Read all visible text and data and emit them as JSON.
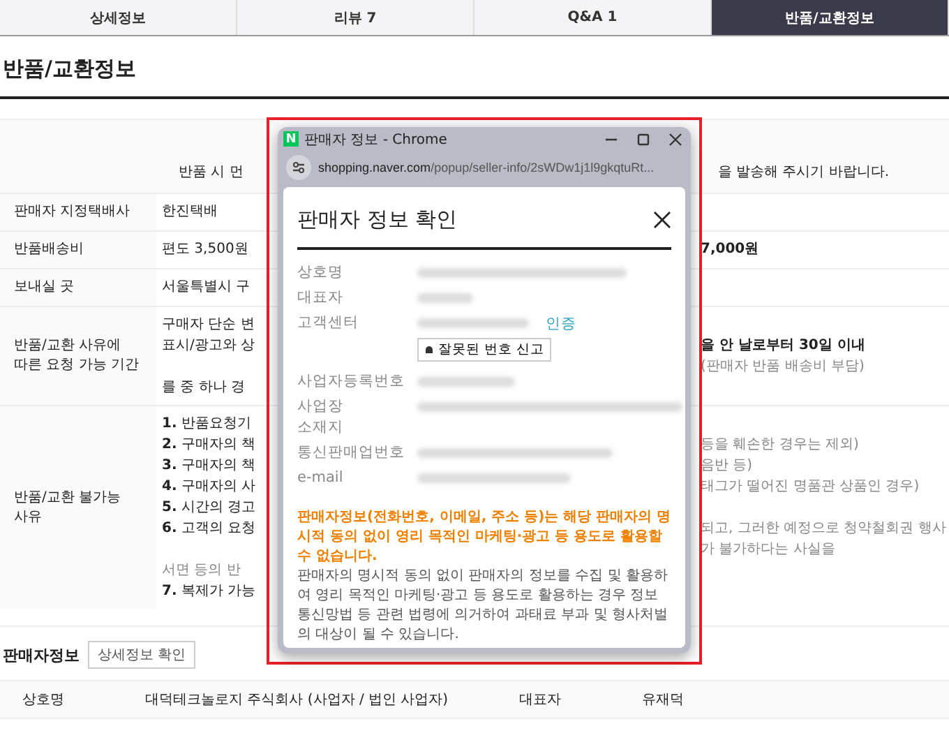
{
  "tabs": [
    {
      "label": "상세정보",
      "selected": false
    },
    {
      "label": "리뷰 7",
      "selected": false
    },
    {
      "label": "Q&A 1",
      "selected": false
    },
    {
      "label": "반품/교환정보",
      "selected": true
    }
  ],
  "heading": "반품/교환정보",
  "notice": {
    "left": "반품 시 먼",
    "right": "을 발송해 주시기 바랍니다."
  },
  "info_rows": [
    {
      "label": "판매자 지정택배사",
      "lines": [
        {
          "kind": "text",
          "left": "한진택배"
        }
      ]
    },
    {
      "label": "반품배송비",
      "lines": [
        {
          "kind": "text",
          "left": "편도 3,500원",
          "right": "7,000원"
        }
      ]
    },
    {
      "label": "보내실 곳",
      "lines": [
        {
          "kind": "text",
          "left": "서울특별시 구"
        }
      ]
    },
    {
      "label": "반품/교환 사유에 따른 요청 가능 기간",
      "lines": [
        {
          "kind": "text",
          "left": "구매자 단순 변"
        },
        {
          "kind": "text",
          "left": "표시/광고와 상",
          "right": "을 안 날로부터 30일 이내",
          "right_note": "(판매자 반품 배송비 부담)"
        },
        {
          "kind": "text",
          "left": "를 중 하나 경"
        }
      ]
    },
    {
      "label": "반품/교환 불가능 사유",
      "lines": [
        {
          "kind": "text",
          "left": "**1.** 반품요청기"
        },
        {
          "kind": "text",
          "left": "**2.** 구매자의 책",
          "right_note": "등을 훼손한 경우는 제외)"
        },
        {
          "kind": "text",
          "left": "**3.** 구매자의 책",
          "right_note": "음반 등)"
        },
        {
          "kind": "text",
          "left": "**4.** 구매자의 사",
          "right_note": "태그가 떨어진 명품관 상품인 경우)"
        },
        {
          "kind": "text",
          "left": "**5.** 시간의 경고"
        },
        {
          "kind": "text",
          "left": "**6.** 고객의 요청",
          "right_note": "되고, 그러한 예정으로 청약철회권 행사가 불가하다는 사실을"
        },
        {
          "kind": "sub",
          "left": "서면 등의 반"
        },
        {
          "kind": "text",
          "left": "**7.** 복제가 가능"
        }
      ]
    }
  ],
  "seller": {
    "title": "판매자정보",
    "button": "상세정보 확인",
    "cells": [
      {
        "kind": "label",
        "text": "상호명"
      },
      {
        "kind": "value",
        "text": "대덕테크놀로지 주식회사 (사업자 / 법인 사업자)"
      },
      {
        "kind": "label",
        "text": "대표자"
      },
      {
        "kind": "value",
        "text": "유재덕"
      }
    ]
  },
  "popup": {
    "logo": "N",
    "window_title": "판매자 정보 - Chrome",
    "url_host": "shopping.naver.com",
    "url_path": "/popup/seller-info/2sWDw1j1l9gkqtuRt...",
    "title": "판매자 정보 확인",
    "fields": [
      {
        "label": "상호명",
        "blurred": true
      },
      {
        "label": "대표자",
        "blurred": true
      },
      {
        "label": "고객센터",
        "blurred": true,
        "link": "인증",
        "action": "잘못된 번호 신고"
      },
      {
        "label": "사업자등록번호",
        "blurred": true
      },
      {
        "label": "사업장\n소재지",
        "blurred": true
      },
      {
        "label": "통신판매업번호",
        "blurred": true
      },
      {
        "label": "e-mail",
        "blurred": true
      }
    ],
    "warning": "판매자정보(전화번호, 이메일, 주소 등)는 해당 판매자의 명시적 동의 없이 영리 목적인 마케팅·광고 등 용도로 활용할 수 없습니다.",
    "notice": "판매자의 명시적 동의 없이 판매자의 정보를 수집 및 활용하여 영리 목적인 마케팅·광고 등 용도로 활용하는 경우 정보통신망법 등 관련 법령에 의거하여 과태료 부과 및 형사처벌의 대상이 될 수 있습니다."
  }
}
